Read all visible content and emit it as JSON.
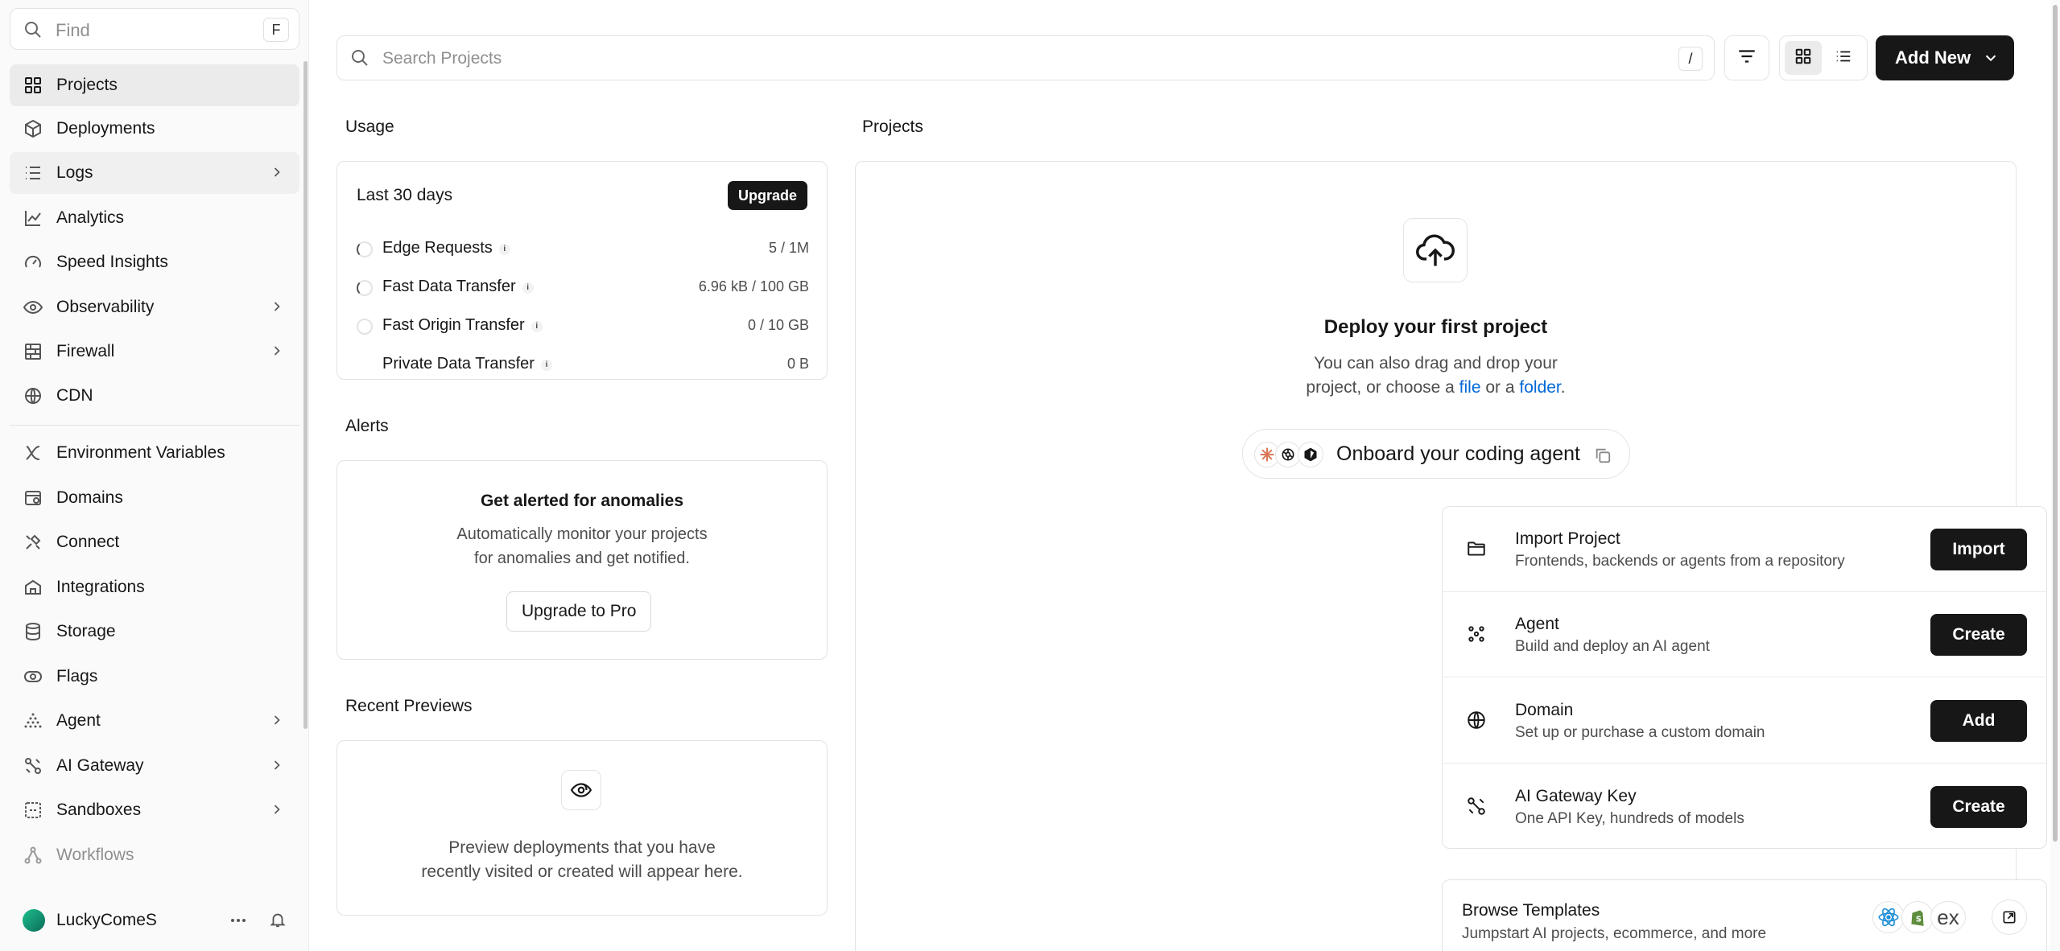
{
  "sidebar": {
    "find_placeholder": "Find",
    "find_shortcut": "F",
    "items": [
      {
        "label": "Projects",
        "icon": "grid-icon"
      },
      {
        "label": "Deployments",
        "icon": "cube-icon"
      },
      {
        "label": "Logs",
        "icon": "logs-icon"
      },
      {
        "label": "Analytics",
        "icon": "chart-line-icon"
      },
      {
        "label": "Speed Insights",
        "icon": "gauge-icon"
      },
      {
        "label": "Observability",
        "icon": "eye-icon"
      },
      {
        "label": "Firewall",
        "icon": "firewall-icon"
      },
      {
        "label": "CDN",
        "icon": "globe-icon"
      },
      {
        "label": "Environment Variables",
        "icon": "variable-icon"
      },
      {
        "label": "Domains",
        "icon": "domain-icon"
      },
      {
        "label": "Connect",
        "icon": "plug-icon"
      },
      {
        "label": "Integrations",
        "icon": "integrations-icon"
      },
      {
        "label": "Storage",
        "icon": "database-icon"
      },
      {
        "label": "Flags",
        "icon": "toggle-icon"
      },
      {
        "label": "Agent",
        "icon": "agent-icon"
      },
      {
        "label": "AI Gateway",
        "icon": "ai-gateway-icon"
      },
      {
        "label": "Sandboxes",
        "icon": "sandbox-icon"
      },
      {
        "label": "Workflows",
        "icon": "workflow-icon"
      }
    ],
    "user_name": "LuckyComeS"
  },
  "toolbar": {
    "search_placeholder": "Search Projects",
    "search_shortcut": "/",
    "add_new_label": "Add New"
  },
  "usage": {
    "section_title": "Usage",
    "period": "Last 30 days",
    "upgrade_label": "Upgrade",
    "rows": [
      {
        "name": "Edge Requests",
        "value": "5 / 1M"
      },
      {
        "name": "Fast Data Transfer",
        "value": "6.96 kB / 100 GB"
      },
      {
        "name": "Fast Origin Transfer",
        "value": "0 / 10 GB"
      },
      {
        "name": "Private Data Transfer",
        "value": "0 B"
      }
    ]
  },
  "alerts": {
    "section_title": "Alerts",
    "title": "Get alerted for anomalies",
    "desc_line1": "Automatically monitor your projects",
    "desc_line2": "for anomalies and get notified.",
    "button_label": "Upgrade to Pro"
  },
  "previews": {
    "section_title": "Recent Previews",
    "desc_line1": "Preview deployments that you have",
    "desc_line2": "recently visited or created will appear here."
  },
  "projects": {
    "section_title": "Projects",
    "deploy_title": "Deploy your first project",
    "deploy_line1": "You can also drag and drop your",
    "deploy_line2_a": "project, or choose a ",
    "file_link": "file",
    "deploy_line2_b": " or a ",
    "folder_link": "folder",
    "deploy_line2_c": ".",
    "onboard_label": "Onboard your coding agent",
    "actions": [
      {
        "title": "Import Project",
        "desc": "Frontends, backends or agents from a repository",
        "button": "Import",
        "icon": "folder-icon"
      },
      {
        "title": "Agent",
        "desc": "Build and deploy an AI agent",
        "button": "Create",
        "icon": "agent-icon"
      },
      {
        "title": "Domain",
        "desc": "Set up or purchase a custom domain",
        "button": "Add",
        "icon": "globe-icon"
      },
      {
        "title": "AI Gateway Key",
        "desc": "One API Key, hundreds of models",
        "button": "Create",
        "icon": "ai-gateway-icon"
      }
    ],
    "browse_title": "Browse Templates",
    "browse_desc": "Jumpstart AI projects, ecommerce, and more",
    "template_ex": "ex"
  }
}
